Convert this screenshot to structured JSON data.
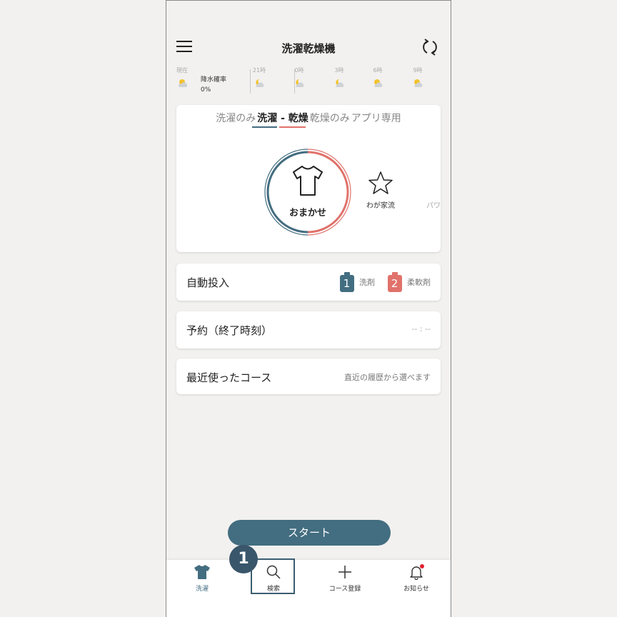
{
  "header": {
    "title": "洗濯乾燥機"
  },
  "weather": {
    "now_label": "現在",
    "rain_label": "降水確率",
    "rain_value": "0%",
    "times": [
      "21時",
      "0時",
      "3時",
      "6時",
      "9時"
    ]
  },
  "mode_tabs": [
    {
      "label": "洗濯のみ",
      "active": false
    },
    {
      "label": "洗濯 - 乾燥",
      "active": true
    },
    {
      "label": "乾燥のみ",
      "active": false
    },
    {
      "label": "アプリ専用",
      "active": false
    }
  ],
  "courses": {
    "selected": "おまかせ",
    "favorite": "わが家流",
    "partial_next": "パワ"
  },
  "auto_dose": {
    "title": "自動投入",
    "slot1_num": "1",
    "slot1_label": "洗剤",
    "slot2_num": "2",
    "slot2_label": "柔軟剤"
  },
  "reservation": {
    "title": "予約（終了時刻）",
    "value": "-- : --"
  },
  "recent": {
    "title": "最近使ったコース",
    "hint": "直近の履歴から選べます"
  },
  "start_label": "スタート",
  "step_badge": "1",
  "bottom_nav": [
    {
      "label": "洗濯",
      "icon": "shirt-icon",
      "active": true
    },
    {
      "label": "検索",
      "icon": "search-icon",
      "active": false
    },
    {
      "label": "コース登録",
      "icon": "plus-icon",
      "active": false
    },
    {
      "label": "お知らせ",
      "icon": "bell-icon",
      "active": false
    }
  ],
  "colors": {
    "wash": "#436d80",
    "dry": "#e0726b",
    "accent": "#436d80",
    "notification": "#e02030"
  }
}
